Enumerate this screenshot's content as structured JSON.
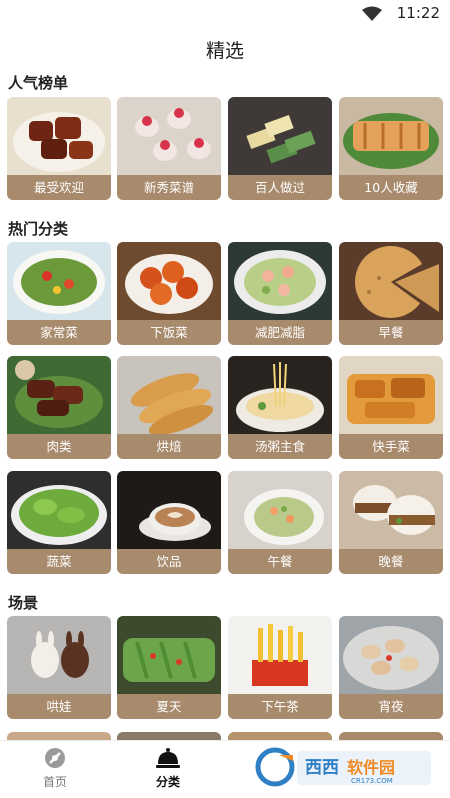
{
  "status_bar": {
    "time": "11:22",
    "wifi_icon": "wifi-icon"
  },
  "header": {
    "title": "精选"
  },
  "sections": [
    {
      "title": "人气榜单",
      "cards": [
        "最受欢迎",
        "新秀菜谱",
        "百人做过",
        "10人收藏"
      ]
    },
    {
      "title": "热门分类",
      "cards": [
        "家常菜",
        "下饭菜",
        "减肥减脂",
        "早餐",
        "肉类",
        "烘焙",
        "汤粥主食",
        "快手菜",
        "蔬菜",
        "饮品",
        "午餐",
        "晚餐"
      ]
    },
    {
      "title": "场景",
      "cards": [
        "哄娃",
        "夏天",
        "下午茶",
        "宵夜"
      ]
    }
  ],
  "bottom_nav": [
    {
      "label": "首页",
      "icon": "home-icon",
      "active": false
    },
    {
      "label": "分类",
      "icon": "category-bell-icon",
      "active": true
    }
  ],
  "watermark": {
    "text": "西西软件园",
    "sub": "CR173.COM"
  },
  "colors": {
    "label_bg": "#a88a6c",
    "accent": "#ffffff"
  }
}
